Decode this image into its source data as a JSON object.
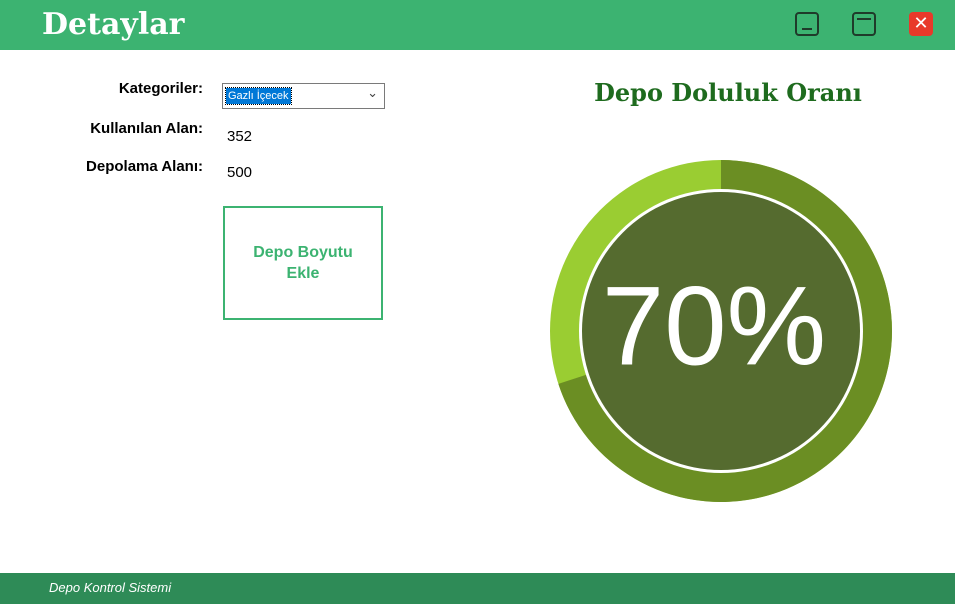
{
  "window": {
    "title": "Detaylar",
    "minimize_icon": "minimize-icon",
    "maximize_icon": "maximize-icon",
    "close_glyph": "✕"
  },
  "form": {
    "category_label": "Kategoriler:",
    "category_value": "Gazlı İçecek",
    "used_label": "Kullanılan Alan:",
    "used_value": "352",
    "storage_label": "Depolama Alanı:",
    "storage_value": "500",
    "add_button_label": "Depo Boyutu Ekle"
  },
  "chart_data": {
    "type": "gauge",
    "title": "Depo Doluluk Oranı",
    "value_percent": 70,
    "value_label": "70%",
    "colors": {
      "filled": "#6b8e23",
      "remaining": "#9acd32",
      "center": "#556b2f",
      "text": "#ffffff"
    }
  },
  "footer": {
    "text": "Depo Kontrol Sistemi"
  },
  "colors": {
    "titlebar": "#3cb371",
    "accent": "#3cb371",
    "footer": "#2e8b57"
  }
}
